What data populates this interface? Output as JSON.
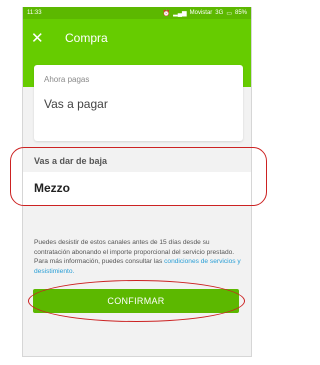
{
  "status_bar": {
    "time": "11:33",
    "operator": "Movistar",
    "network": "3G",
    "battery": "85%"
  },
  "app_bar": {
    "title": "Compra",
    "close_icon": "close-icon"
  },
  "top_card": {
    "label": "Ahora pagas",
    "value": "Vas a pagar"
  },
  "baja_section": {
    "label": "Vas a dar de baja",
    "value": "Mezzo"
  },
  "info": {
    "text": "Puedes desistir de estos canales antes de 15 días desde su contratación abonando el importe proporcional del servicio prestado. Para más información, puedes consultar las ",
    "link_text": "condiciones de servicios y desistimiento."
  },
  "confirm_button": {
    "label": "CONFIRMAR"
  },
  "colors": {
    "brand_green": "#66cc00",
    "button_green": "#5cb800",
    "link_blue": "#2a9fd6",
    "highlight_red": "#cc2222"
  }
}
